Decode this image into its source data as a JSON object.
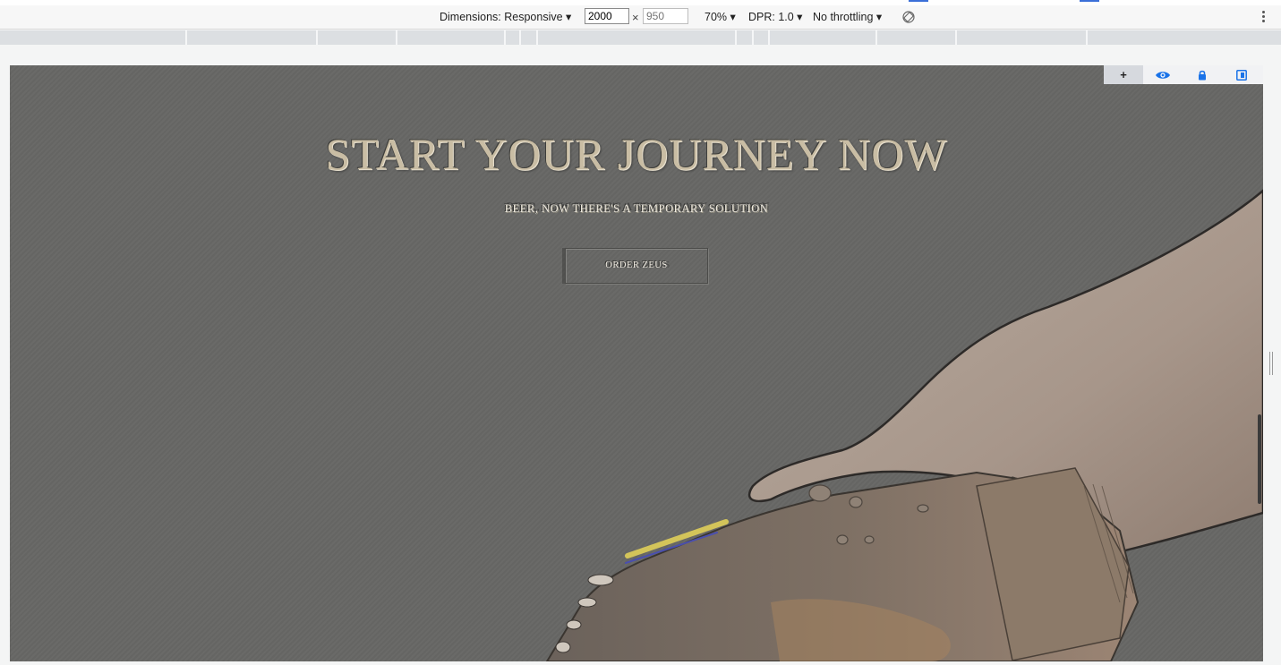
{
  "devtools": {
    "dimensions_label": "Dimensions: Responsive ▾",
    "width_value": "2000",
    "height_placeholder": "950",
    "times_symbol": "×",
    "zoom": "70% ▾",
    "dpr": "DPR: 1.0 ▾",
    "throttling": "No throttling ▾",
    "icons": [
      "rotate-icon",
      "kebab-menu-icon"
    ]
  },
  "overlay_tools": {
    "icons": [
      "plus-icon",
      "eye-icon",
      "lock-icon",
      "toggle-icon"
    ],
    "plus_label": "+",
    "accent_color": "#1a73e8"
  },
  "hero": {
    "title": "START YOUR JOURNEY NOW",
    "subtitle": "BEER, NOW THERE'S A TEMPORARY SOLUTION",
    "cta_label": "ORDER ZEUS",
    "background_color": "#676765",
    "title_color": "#c9bda4"
  }
}
